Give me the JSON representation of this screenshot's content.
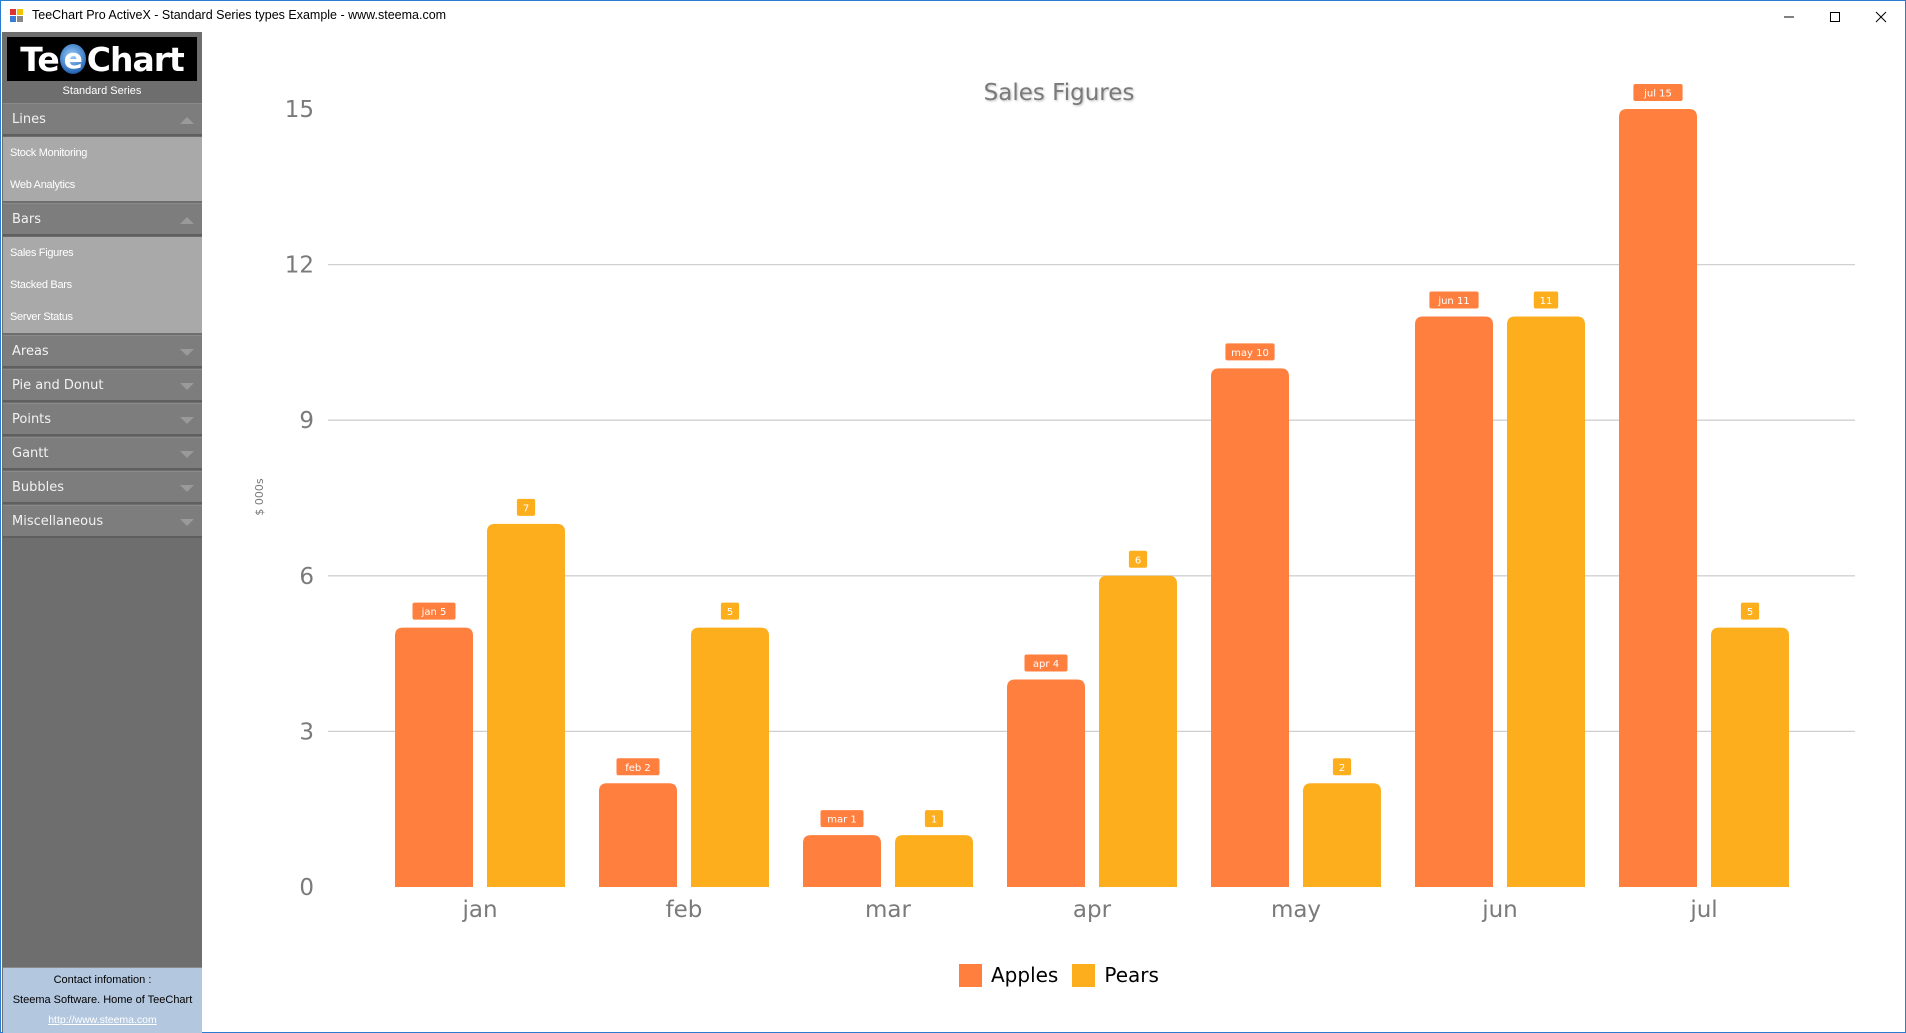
{
  "window": {
    "title": "TeeChart Pro ActiveX - Standard Series types Example - www.steema.com",
    "controls": [
      "minimize",
      "maximize",
      "close"
    ]
  },
  "sidebar": {
    "logo_text": {
      "pre": "Te",
      "e": "e",
      "post": "Chart"
    },
    "subtitle": "Standard Series",
    "sections": [
      {
        "label": "Lines",
        "expanded": true,
        "items": [
          "Stock Monitoring",
          "Web Analytics"
        ]
      },
      {
        "label": "Bars",
        "expanded": true,
        "items": [
          "Sales Figures",
          "Stacked Bars",
          "Server Status"
        ]
      },
      {
        "label": "Areas",
        "expanded": false,
        "items": []
      },
      {
        "label": "Pie and Donut",
        "expanded": false,
        "items": []
      },
      {
        "label": "Points",
        "expanded": false,
        "items": []
      },
      {
        "label": "Gantt",
        "expanded": false,
        "items": []
      },
      {
        "label": "Bubbles",
        "expanded": false,
        "items": []
      },
      {
        "label": "Miscellaneous",
        "expanded": false,
        "items": []
      }
    ],
    "contact": {
      "heading": "Contact infomation :",
      "company": "Steema Software. Home of TeeChart",
      "link": "http://www.steema.com"
    }
  },
  "colors": {
    "apples": "#ff7f3f",
    "pears": "#fdae1d",
    "grid": "#d0d0d0",
    "axis_text": "#7a7a7a",
    "window_border": "#2b7bd0"
  },
  "chart_data": {
    "type": "bar",
    "title": "Sales Figures",
    "xlabel": "",
    "ylabel": "$ 000s",
    "categories": [
      "jan",
      "feb",
      "mar",
      "apr",
      "may",
      "jun",
      "jul"
    ],
    "series": [
      {
        "name": "Apples",
        "values": [
          5,
          2,
          1,
          4,
          10,
          11,
          15
        ],
        "labels": [
          "jan 5",
          "feb 2",
          "mar 1",
          "apr 4",
          "may 10",
          "jun 11",
          "jul 15"
        ]
      },
      {
        "name": "Pears",
        "values": [
          7,
          5,
          1,
          6,
          2,
          11,
          5
        ],
        "labels": [
          "7",
          "5",
          "1",
          "6",
          "2",
          "11",
          "5"
        ]
      }
    ],
    "ylim": [
      0,
      15
    ],
    "yticks": [
      0,
      3,
      6,
      9,
      12,
      15
    ],
    "grid": true,
    "legend": "bottom-center"
  }
}
